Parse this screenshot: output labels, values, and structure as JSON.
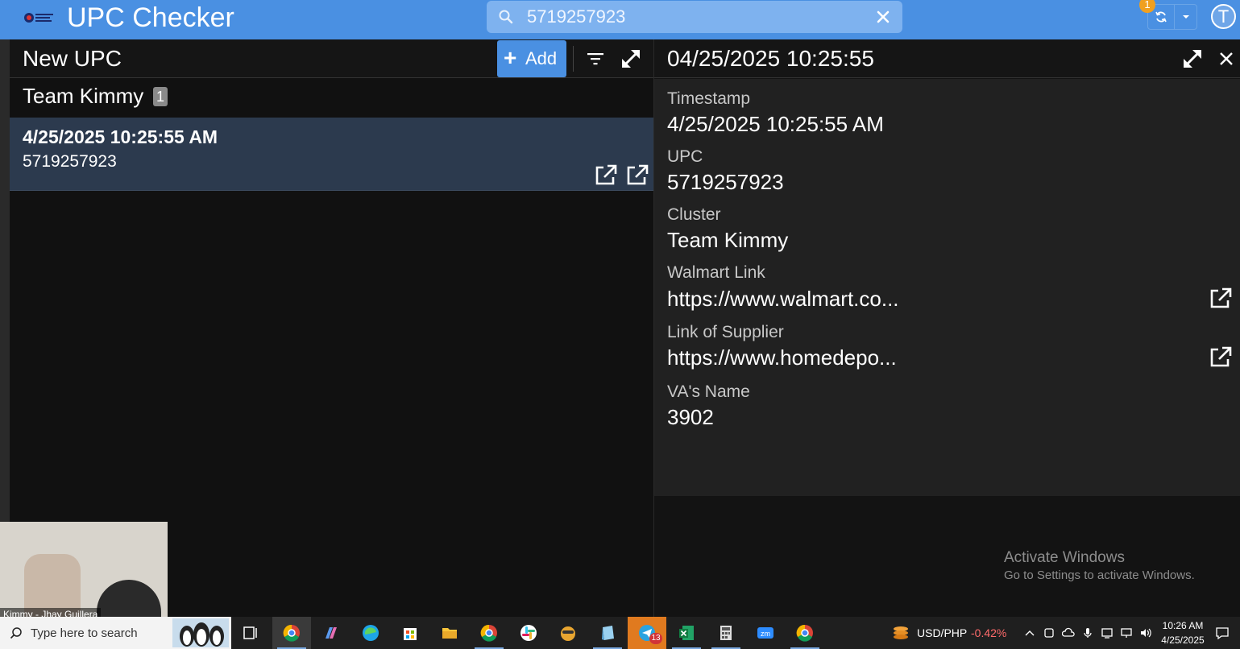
{
  "app": {
    "title": "UPC Checker",
    "search_value": "5719257923",
    "sync_badge": "1",
    "avatar_initial": "T"
  },
  "left_panel": {
    "title": "New UPC",
    "add_label": "Add",
    "group": {
      "name": "Team Kimmy",
      "count": "1"
    },
    "items": [
      {
        "timestamp": "4/25/2025 10:25:55 AM",
        "upc": "5719257923"
      }
    ]
  },
  "detail": {
    "title": "04/25/2025 10:25:55",
    "fields": [
      {
        "label": "Timestamp",
        "value": "4/25/2025 10:25:55 AM"
      },
      {
        "label": "UPC",
        "value": "5719257923"
      },
      {
        "label": "Cluster",
        "value": "Team Kimmy"
      },
      {
        "label": "Walmart Link",
        "value": "https://www.walmart.co..."
      },
      {
        "label": "Link of Supplier",
        "value": "https://www.homedepo..."
      },
      {
        "label": "VA's Name",
        "value": "3902"
      }
    ]
  },
  "watermark": {
    "title": "Activate Windows",
    "subtitle": "Go to Settings to activate Windows."
  },
  "webcam": {
    "name": "Kimmy - Jhay Guillera"
  },
  "taskbar": {
    "search_placeholder": "Type here to search",
    "badge_count": "13",
    "currency": "USD/PHP",
    "currency_change": "-0.42%",
    "time": "10:26 AM",
    "date": "4/25/2025"
  },
  "colors": {
    "accent": "#4a90e2",
    "selected_row": "#2c3a4e",
    "negative": "#ff6b6b"
  }
}
